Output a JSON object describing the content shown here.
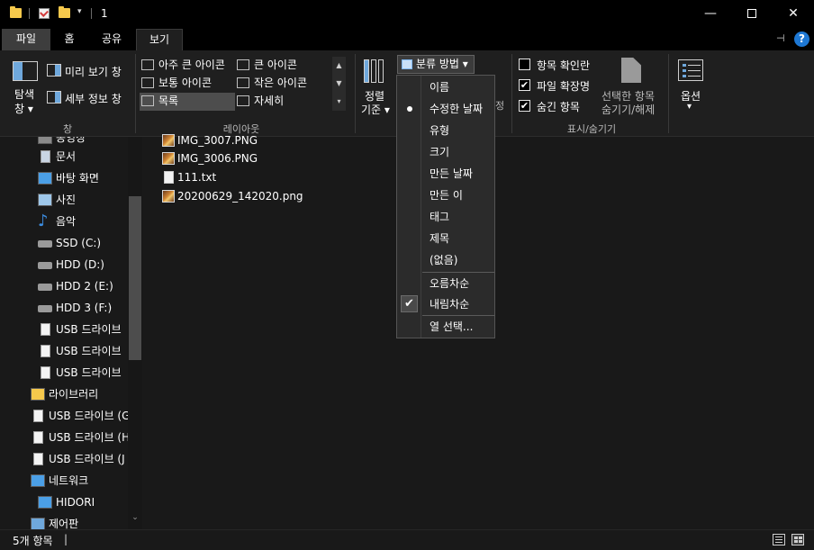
{
  "title": "1",
  "tabs": {
    "file": "파일",
    "home": "홈",
    "share": "공유",
    "view": "보기"
  },
  "help_label": "?",
  "ribbon": {
    "panes": {
      "nav_pane_line1": "탐색",
      "nav_pane_line2": "창 ▾",
      "preview": "미리 보기 창",
      "details": "세부 정보 창",
      "group_label": "창"
    },
    "layout": {
      "extra_large": "아주 큰 아이콘",
      "large": "큰 아이콘",
      "medium": "보통 아이콘",
      "small": "작은 아이콘",
      "list": "목록",
      "details": "자세히",
      "group_label": "레이아웃"
    },
    "current_view": {
      "sort_line1": "정렬",
      "sort_line2": "기준 ▾",
      "group_by": "분류 방법 ▾",
      "partial_label": "정"
    },
    "show_hide": {
      "item_checkboxes": "항목 확인란",
      "file_extensions": "파일 확장명",
      "hidden_items": "숨긴 항목",
      "hide_selected_line1": "선택한 항목",
      "hide_selected_line2": "숨기기/해제",
      "group_label": "표시/숨기기",
      "checks": {
        "item_checkboxes": false,
        "file_extensions": true,
        "hidden_items": true
      }
    },
    "options_line1": "옵션",
    "options_line2": "▾"
  },
  "nav": [
    {
      "label": "동영상",
      "icon": "video-icon"
    },
    {
      "label": "문서",
      "icon": "document-icon"
    },
    {
      "label": "바탕 화면",
      "icon": "desktop-icon"
    },
    {
      "label": "사진",
      "icon": "pictures-icon"
    },
    {
      "label": "음악",
      "icon": "music-icon"
    },
    {
      "label": "SSD (C:)",
      "icon": "drive-icon"
    },
    {
      "label": "HDD (D:)",
      "icon": "drive-icon"
    },
    {
      "label": "HDD 2 (E:)",
      "icon": "drive-icon"
    },
    {
      "label": "HDD 3 (F:)",
      "icon": "drive-icon"
    },
    {
      "label": "USB 드라이브",
      "icon": "usb-drive-icon"
    },
    {
      "label": "USB 드라이브",
      "icon": "usb-drive-icon"
    },
    {
      "label": "USB 드라이브",
      "icon": "usb-drive-icon"
    },
    {
      "label": "라이브러리",
      "icon": "library-icon"
    },
    {
      "label": "USB 드라이브 (G",
      "icon": "usb-drive-icon"
    },
    {
      "label": "USB 드라이브 (H",
      "icon": "usb-drive-icon"
    },
    {
      "label": "USB 드라이브 (J",
      "icon": "usb-drive-icon"
    },
    {
      "label": "네트워크",
      "icon": "network-icon"
    },
    {
      "label": "HIDORI",
      "icon": "computer-icon"
    },
    {
      "label": "제어판",
      "icon": "control-panel-icon"
    }
  ],
  "files": [
    {
      "name": "IMG_3007.PNG",
      "type": "image"
    },
    {
      "name": "IMG_3006.PNG",
      "type": "image"
    },
    {
      "name": "111.txt",
      "type": "text"
    },
    {
      "name": "20200629_142020.png",
      "type": "image"
    }
  ],
  "group_by_menu": {
    "items": [
      "이름",
      "수정한 날짜",
      "유형",
      "크기",
      "만든 날짜",
      "만든 이",
      "태그",
      "제목",
      "(없음)"
    ],
    "selected": "수정한 날짜",
    "order": [
      "오름차순",
      "내림차순"
    ],
    "order_selected": "내림차순",
    "choose_columns": "열 선택..."
  },
  "status": {
    "count": "5개 항목"
  }
}
